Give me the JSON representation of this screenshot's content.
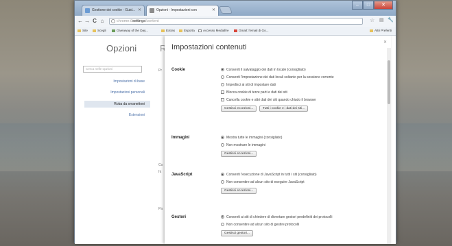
{
  "browser": {
    "tabs": [
      {
        "label": "Gestione dei cookie - Guid..."
      },
      {
        "label": "Opzioni - Impostazioni con"
      }
    ],
    "window_buttons": {
      "minimize": "–",
      "maximize": "□",
      "close": "✕"
    },
    "nav": {
      "back": "←",
      "forward": "→",
      "reload": "C",
      "home": "⌂"
    },
    "address": {
      "prefix": "chrome://",
      "host": "settings",
      "path": "/content"
    },
    "bookmarks": [
      {
        "label": "Site"
      },
      {
        "label": "Scegli"
      },
      {
        "label": "Giveaway of the Day..."
      },
      {
        "label": "Extras"
      },
      {
        "label": "Esporta"
      },
      {
        "label": "Accesso Mediafire"
      },
      {
        "label": "Gmail: l'email di Go..."
      }
    ],
    "other_bookmarks": "Altri Preferiti"
  },
  "sidebar": {
    "title": "Opzioni",
    "search_placeholder": "Cerca nelle opzioni",
    "items": [
      {
        "label": "Impostazioni di base"
      },
      {
        "label": "Impostazioni personali"
      },
      {
        "label": "Roba da smanettoni"
      },
      {
        "label": "Estensioni"
      }
    ]
  },
  "background_page": {
    "heading_letter": "R",
    "labels": [
      "Pr",
      "Co",
      "ht",
      "Pa"
    ]
  },
  "content_settings": {
    "title": "Impostazioni contenuti",
    "close": "✕",
    "cookie": {
      "label": "Cookie",
      "options": [
        "Consenti il salvataggio dei dati in locale (consigliato)",
        "Consenti l'impostazione dei dati locali soltanto per la sessione corrente",
        "Impedisci ai siti di impostare dati"
      ],
      "checkboxes": [
        "Blocca cookie di terze parti e dati dei siti",
        "Cancella cookie e altri dati dei siti quando chiudo il browser"
      ],
      "buttons": [
        "Gestisci eccezioni...",
        "Tutti i cookie e i dati dei siti..."
      ]
    },
    "images": {
      "label": "Immagini",
      "options": [
        "Mostra tutte le immagini (consigliato)",
        "Non mostrare le immagini"
      ],
      "button": "Gestisci eccezioni..."
    },
    "javascript": {
      "label": "JavaScript",
      "options": [
        "Consenti l'esecuzione di JavaScript in tutti i siti (consigliato)",
        "Non consentire ad alcun sito di eseguire JavaScript"
      ],
      "button": "Gestisci eccezioni..."
    },
    "handlers": {
      "label": "Gestori",
      "options": [
        "Consenti ai siti di chiedere di diventare gestori predefiniti dei protocolli",
        "Non consentire ad alcun sito di gestire protocolli"
      ],
      "button": "Gestisci gestori..."
    }
  }
}
